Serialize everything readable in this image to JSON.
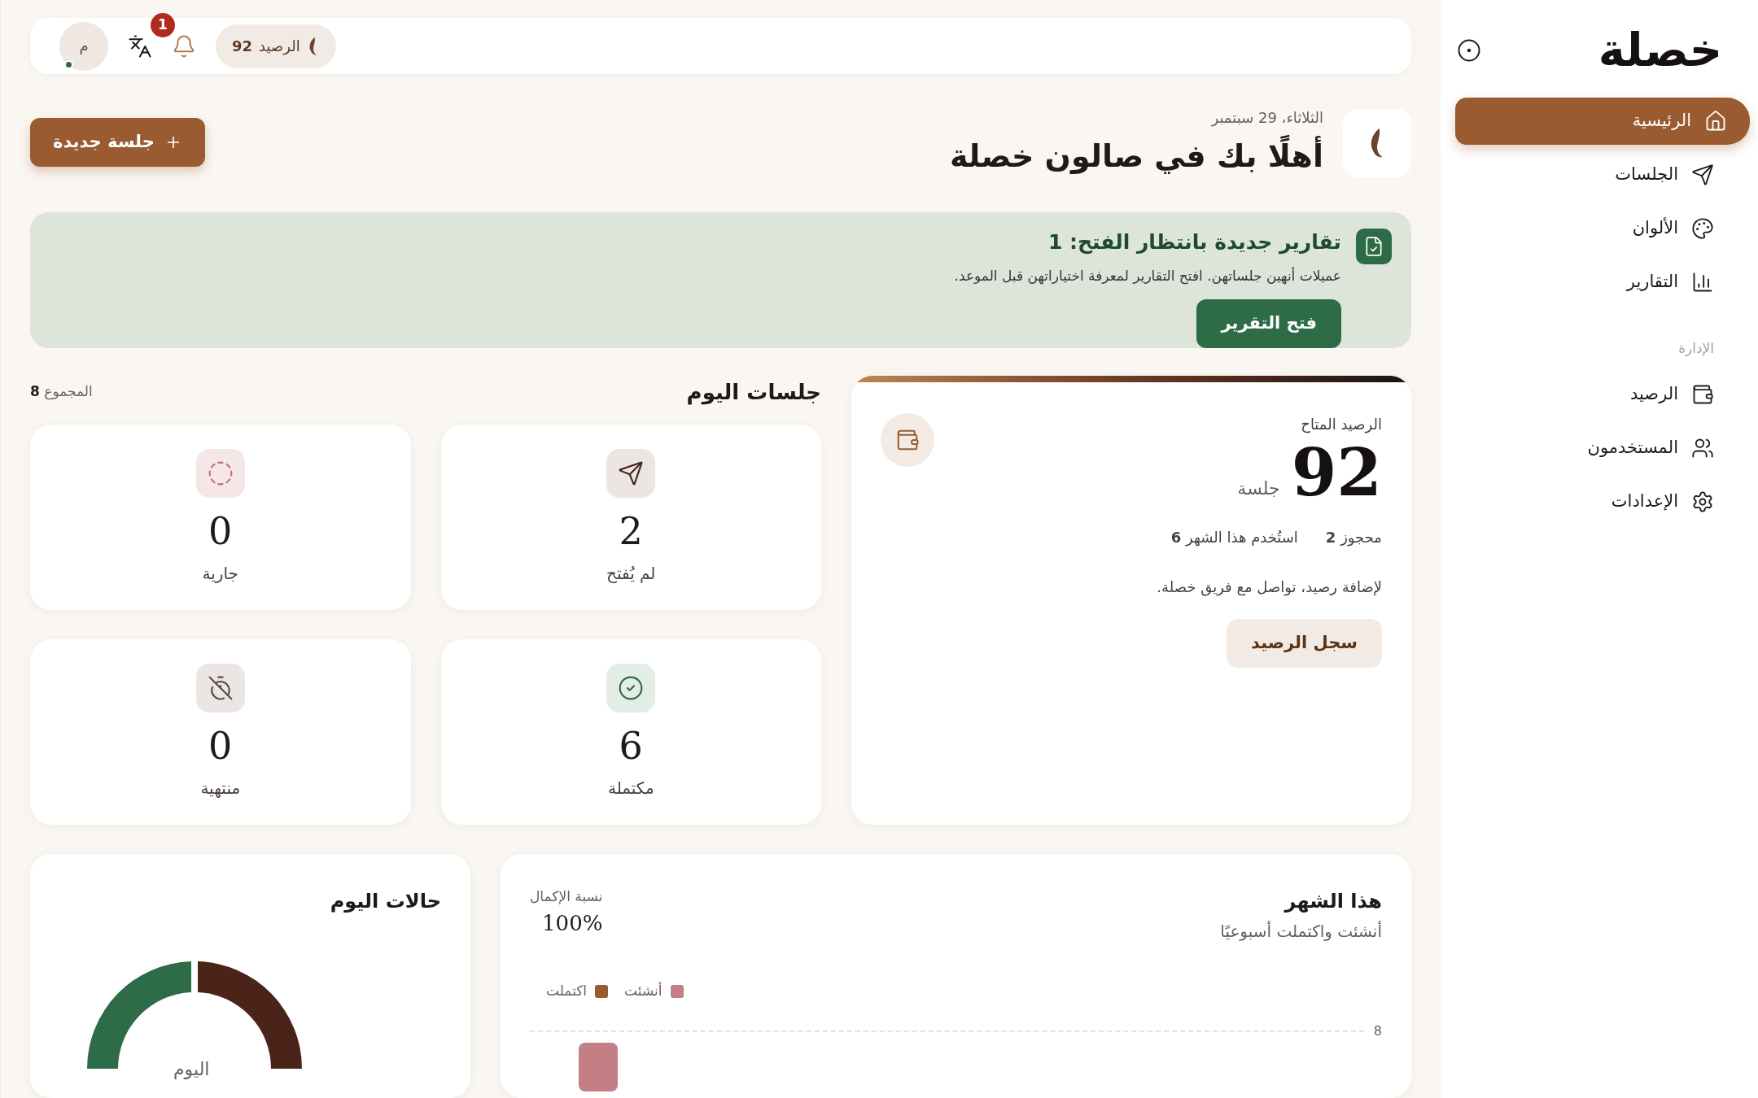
{
  "sidebar": {
    "brand": "خصلة",
    "items": [
      {
        "label": "الرئيسية",
        "kind": "home",
        "selected": true
      },
      {
        "label": "الجلسات",
        "kind": "send",
        "selected": false
      },
      {
        "label": "الألوان",
        "kind": "palette",
        "selected": false
      },
      {
        "label": "التقارير",
        "kind": "chart",
        "selected": false
      }
    ],
    "section_label": "الإدارة",
    "admin_items": [
      {
        "label": "الرصيد",
        "kind": "wallet",
        "selected": false
      },
      {
        "label": "المستخدمون",
        "kind": "users",
        "selected": false
      },
      {
        "label": "الإعدادات",
        "kind": "settings",
        "selected": false
      }
    ]
  },
  "topbar": {
    "balance_label": "الرصيد",
    "balance_value": "92",
    "notifications_count": "1",
    "avatar": {
      "initial": "م",
      "online": true
    }
  },
  "header": {
    "date": "الثلاثاء، 29 سبتمبر",
    "title": "أهلًا بك في صالون خصلة",
    "new_session_button": "جلسة جديدة"
  },
  "banner": {
    "title": "تقارير جديدة بانتظار الفتح: 1",
    "text": "عميلات أنهين جلساتهن. افتح التقارير لمعرفة اختياراتهن قبل الموعد.",
    "button": "فتح التقرير"
  },
  "sessions": {
    "title": "جلسات اليوم",
    "total_label": "المجموع",
    "total": "8",
    "stats": [
      {
        "kind": "unopened",
        "value": "2",
        "label": "لم يُفتح"
      },
      {
        "kind": "ongoing",
        "value": "0",
        "label": "جارية"
      },
      {
        "kind": "completed",
        "value": "6",
        "label": "مكتملة"
      },
      {
        "kind": "ended",
        "value": "0",
        "label": "منتهية"
      }
    ]
  },
  "balance": {
    "label": "الرصيد المتاح",
    "value": "92",
    "unit": "جلسة",
    "reserved_label": "محجوز",
    "reserved": "2",
    "used_label": "استُخدم هذا الشهر",
    "used": "6",
    "note": "لإضافة رصيد، تواصل مع فريق خصلة.",
    "button": "سجل الرصيد"
  },
  "month": {
    "title": "هذا الشهر",
    "subtitle": "أنشئت واكتملت أسبوعيًا",
    "rate_label": "نسبة الإكمال",
    "rate": "100%",
    "legend": [
      {
        "label": "أنشئت",
        "color": "#c47e86"
      },
      {
        "label": "اكتملت",
        "color": "#9a5b30"
      }
    ],
    "tick": "8"
  },
  "today_states": {
    "title": "حالات اليوم",
    "center_label": "اليوم"
  }
}
